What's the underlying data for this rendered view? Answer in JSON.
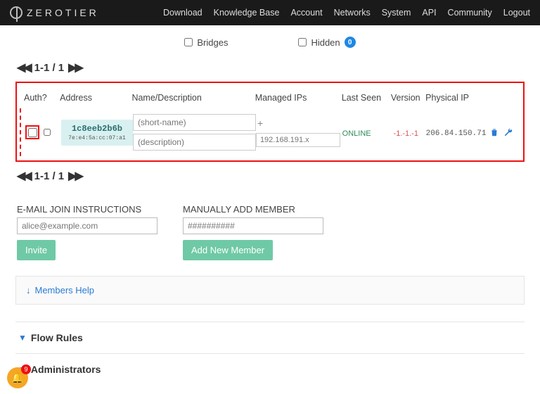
{
  "brand": "ZEROTIER",
  "nav": [
    "Download",
    "Knowledge Base",
    "Account",
    "Networks",
    "System",
    "API",
    "Community",
    "Logout"
  ],
  "filters": {
    "bridges": "Bridges",
    "hidden": "Hidden",
    "hidden_count": "0"
  },
  "pager": "1-1 / 1",
  "columns": {
    "auth": "Auth?",
    "address": "Address",
    "name": "Name/Description",
    "ips": "Managed IPs",
    "last": "Last Seen",
    "version": "Version",
    "phys": "Physical IP"
  },
  "member": {
    "address": "1c8eeb2b6b",
    "fingerprint": "7e:e4:5a:cc:07:a1",
    "short_name_ph": "(short-name)",
    "desc_ph": "(description)",
    "ip_ph": "192.168.191.x",
    "last_seen": "ONLINE",
    "version": "-1.-1.-1",
    "physical_ip": "206.84.150.71"
  },
  "forms": {
    "email_label": "E-MAIL JOIN INSTRUCTIONS",
    "email_ph": "alice@example.com",
    "invite_btn": "Invite",
    "manual_label": "MANUALLY ADD MEMBER",
    "manual_ph": "##########",
    "add_btn": "Add New Member"
  },
  "help_link": "Members Help",
  "sections": {
    "flow": "Flow Rules",
    "admins": "Administrators"
  },
  "notif_count": "9"
}
